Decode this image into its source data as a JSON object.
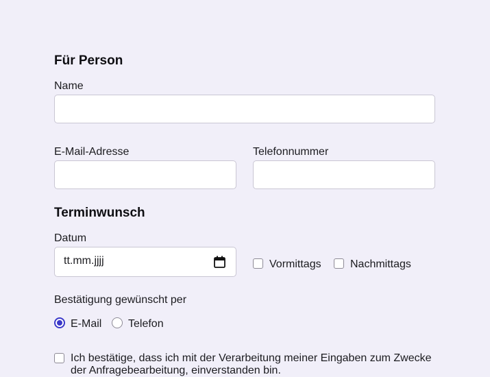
{
  "person": {
    "title": "Für Person",
    "name_label": "Name",
    "name_value": "",
    "email_label": "E-Mail-Adresse",
    "email_value": "",
    "phone_label": "Telefonnummer",
    "phone_value": ""
  },
  "appointment": {
    "title": "Terminwunsch",
    "date_label": "Datum",
    "date_placeholder": "tt.mm.jjjj",
    "morning_label": "Vormittags",
    "morning_checked": false,
    "afternoon_label": "Nachmittags",
    "afternoon_checked": false
  },
  "confirmation": {
    "label": "Bestätigung gewünscht per",
    "options": [
      {
        "label": "E-Mail",
        "checked": true
      },
      {
        "label": "Telefon",
        "checked": false
      }
    ]
  },
  "consent": {
    "text": "Ich bestätige, dass ich mit der Verarbeitung meiner Eingaben zum Zwecke der Anfragebearbeitung, einverstanden bin.",
    "checked": false
  },
  "icons": {
    "date_picker": "calendar-icon"
  },
  "colors": {
    "background": "#f1eff9",
    "accent": "#3b39c9",
    "border": "#c9c6d3"
  }
}
